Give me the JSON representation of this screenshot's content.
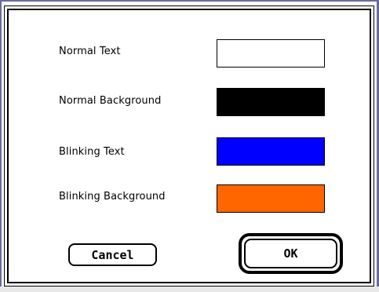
{
  "dialog": {
    "rows": [
      {
        "label": "Normal Text",
        "color": "#ffffff"
      },
      {
        "label": "Normal Background",
        "color": "#000000"
      },
      {
        "label": "Blinking Text",
        "color": "#0000ff"
      },
      {
        "label": "Blinking Background",
        "color": "#ff6600"
      }
    ],
    "buttons": {
      "cancel_label": "Cancel",
      "ok_label": "OK"
    }
  }
}
